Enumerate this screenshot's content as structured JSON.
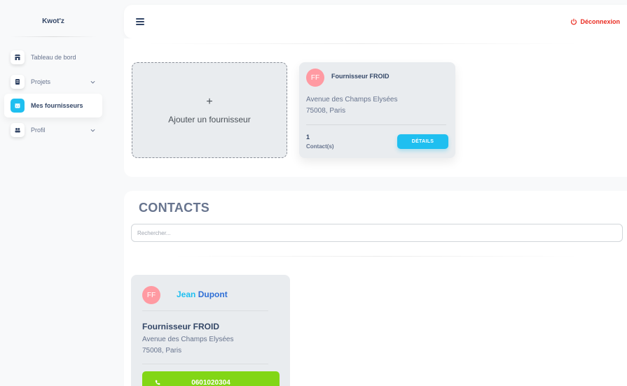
{
  "sidebar": {
    "brand": "Kwot'z",
    "items": [
      {
        "label": "Tableau de bord",
        "icon": "shop-icon",
        "active": false,
        "has_chevron": false
      },
      {
        "label": "Projets",
        "icon": "document-icon",
        "active": false,
        "has_chevron": true
      },
      {
        "label": "Mes fournisseurs",
        "icon": "calendar-icon",
        "active": true,
        "has_chevron": false
      },
      {
        "label": "Profil",
        "icon": "user-group-icon",
        "active": false,
        "has_chevron": true
      }
    ]
  },
  "topbar": {
    "menu_icon": "hamburger-icon",
    "logout_label": "Déconnexion",
    "logout_icon": "power-icon",
    "logout_color": "#ea2a1f"
  },
  "suppliers": {
    "add_plus": "+",
    "add_label": "Ajouter un fournisseur",
    "cards": [
      {
        "initials": "FF",
        "name": "Fournisseur FROID",
        "address_line1": "Avenue des Champs Elysées",
        "address_line2": "75008, Paris",
        "contact_count": "1",
        "contact_label": "Contact(s)",
        "details_label": "DÉTAILS"
      }
    ]
  },
  "contacts": {
    "title": "CONTACTS",
    "search_placeholder": "Rechercher...",
    "cards": [
      {
        "initials": "FF",
        "first_name": "Jean",
        "last_name": "Dupont",
        "company": "Fournisseur FROID",
        "address_line1": "Avenue des Champs Elysées",
        "address_line2": "75008, Paris",
        "phone": "0601020304",
        "phone_icon": "phone-icon"
      }
    ]
  },
  "colors": {
    "accent": "#1fbff0",
    "phone_button": "#82d616",
    "avatar": "#ff9aa2"
  }
}
